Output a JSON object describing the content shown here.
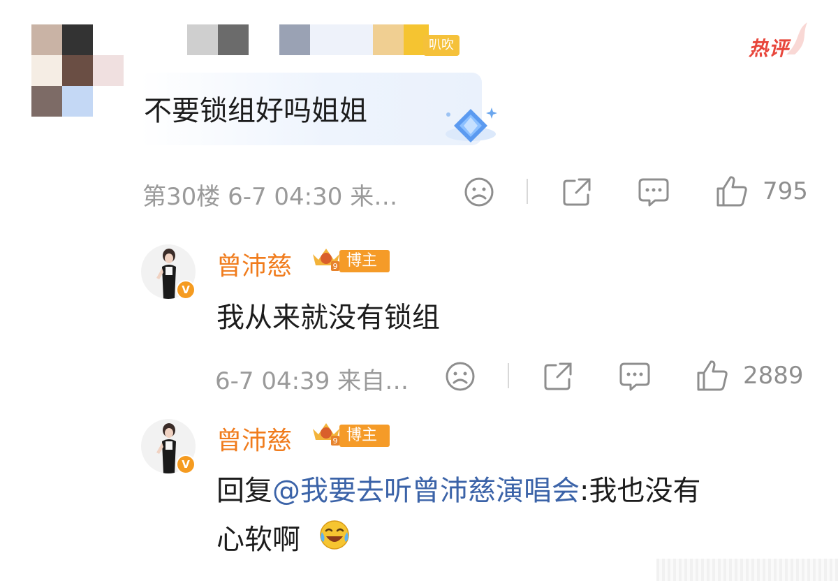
{
  "top_comment": {
    "tag_label": "叭吹",
    "hot_label": "热评",
    "text": "不要锁组好吗姐姐",
    "meta": "第30楼  6-7 04:30  来…",
    "like_count": "795"
  },
  "replies": [
    {
      "username": "曾沛慈",
      "badge_label": "博主",
      "text_lines": [
        "我从来就没有锁组"
      ],
      "meta": "6-7 04:39  来自…",
      "like_count": "2889"
    },
    {
      "username": "曾沛慈",
      "badge_label": "博主",
      "reply_prefix": "回复",
      "mention": "@我要去听曾沛慈演唱会",
      "reply_rest": ":我也没有",
      "line2": "心软啊"
    }
  ],
  "icons": {
    "dislike": "frown-face-icon",
    "share": "share-icon",
    "comment": "comment-icon",
    "like": "thumbs-up-icon",
    "verified": "verified-v-icon",
    "crown": "crown-level-icon",
    "emoji": "laugh-cry-emoji-icon",
    "diamond": "diamond-badge-icon"
  },
  "colors": {
    "username": "#f07c1d",
    "mention": "#3b63a8",
    "hot": "#e8463b",
    "badge": "#f59b28"
  }
}
